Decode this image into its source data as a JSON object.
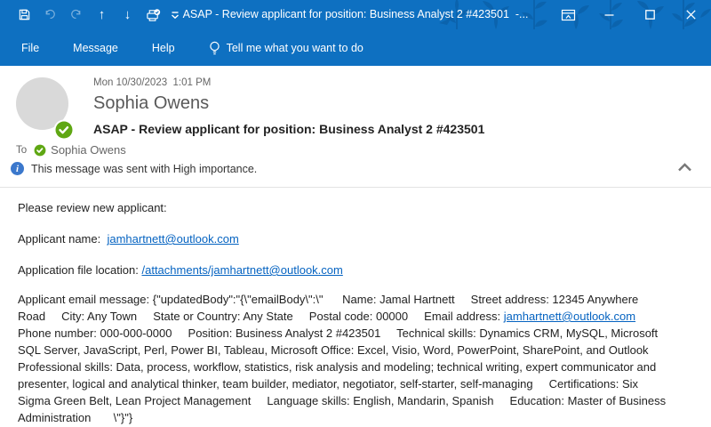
{
  "titlebar": {
    "title": "ASAP - Review applicant for position: Business Analyst 2 #423501  -..."
  },
  "ribbon": {
    "tabs": [
      {
        "label": "File"
      },
      {
        "label": "Message"
      },
      {
        "label": "Help"
      }
    ],
    "tell_me": "Tell me what you want to do"
  },
  "message": {
    "sent_datetime": "Mon 10/30/2023  1:01 PM",
    "sender_name": "Sophia Owens",
    "subject": "ASAP - Review applicant for position: Business Analyst 2 #423501",
    "to_label": "To",
    "to_recipient": "Sophia Owens",
    "info_bar": "This message was sent with High importance."
  },
  "body": {
    "intro": "Please review new applicant:",
    "applicant_name": {
      "label": "Applicant name:  ",
      "link": "jamhartnett@outlook.com"
    },
    "file_location": {
      "label": "Application file location: ",
      "link": "/attachments/jamhartnett@outlook.com"
    },
    "email_message": {
      "before_link": "Applicant email message: {\"updatedBody\":\"{\\\"emailBody\\\":\\\"      Name: Jamal Hartnett     Street address: 12345 Anywhere Road     City: Any Town     State or Country: Any State     Postal code: 00000     Email address: ",
      "link": "jamhartnett@outlook.com",
      "after_link": "     Phone number: 000-000-0000     Position: Business Analyst 2 #423501     Technical skills: Dynamics CRM, MySQL, Microsoft SQL Server, JavaScript, Perl, Power BI, Tableau, Microsoft Office: Excel, Visio, Word, PowerPoint, SharePoint, and Outlook     Professional skills: Data, process, workflow, statistics, risk analysis and modeling; technical writing, expert communicator and presenter, logical and analytical thinker, team builder, mediator, negotiator, self-starter, self-managing     Certifications: Six Sigma Green Belt, Lean Project Management     Language skills: English, Mandarin, Spanish     Education: Master of Business Administration       \\\"}\"}"
    }
  },
  "icons": {
    "save": "floppy-disk",
    "undo": "curved-arrow-left",
    "redo": "curved-arrow-right",
    "previous_item": "↑",
    "next_item": "↓",
    "print_approve": "printer-with-check",
    "customize_qat": "bar-chevron-down",
    "ribbon_display_options": "box-up-arrow",
    "minimize": "—",
    "restore": "□",
    "close": "✕",
    "tell_me": "lightbulb",
    "info": "i-circle",
    "presence_available": "green-check-circle",
    "collapse_header": "chevron-up"
  },
  "colors": {
    "titlebar_blue": "#0e70c1",
    "pattern_blue": "#0b63ad",
    "link_blue": "#0563C1",
    "presence_green": "#5fa713",
    "info_blue": "#3b78cc",
    "avatar_gray": "#d9d9d9",
    "muted_text": "#666666"
  }
}
